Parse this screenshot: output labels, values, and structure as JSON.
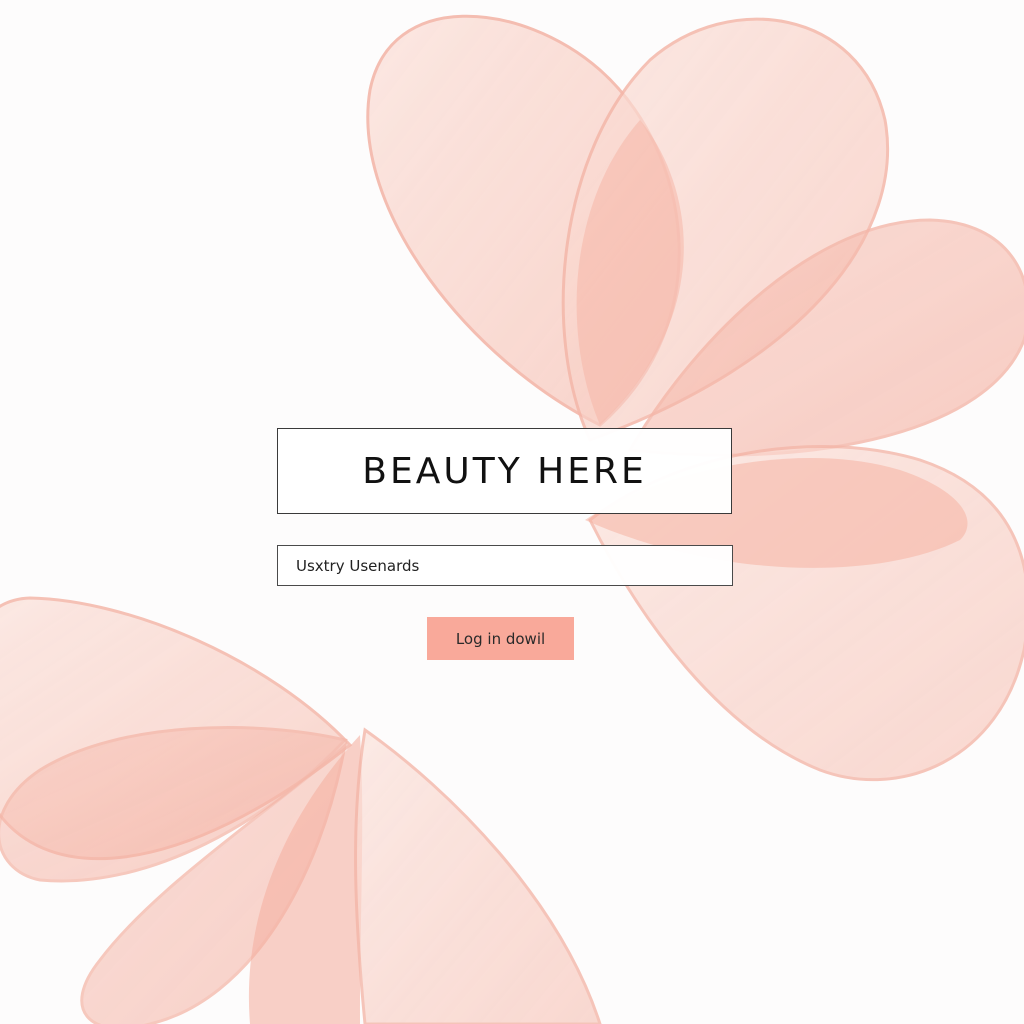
{
  "app": {
    "brand_title": "BEAUTY HERE"
  },
  "login_form": {
    "username_value": "Usxtry Usenards",
    "login_button_label": "Log in dowil"
  },
  "colors": {
    "accent": "#f9a99a",
    "petal_light": "#f8d2c9",
    "petal_mid": "#f5b3a5",
    "border": "#3a3a3a"
  }
}
